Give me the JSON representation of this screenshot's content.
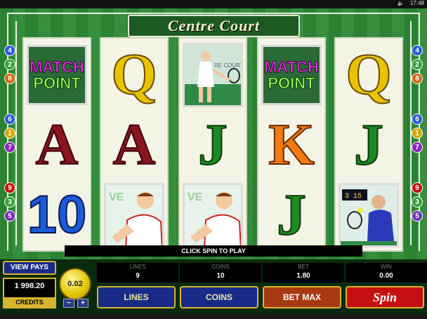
{
  "system": {
    "time": "17:48"
  },
  "title": "Centre Court",
  "reels": [
    [
      "MATCH POINT",
      "A",
      "10"
    ],
    [
      "Q",
      "A",
      "player-serve"
    ],
    [
      "player-woman",
      "J",
      "player-serve"
    ],
    [
      "MATCH POINT",
      "K",
      "J"
    ],
    [
      "Q",
      "J",
      "player-volley"
    ]
  ],
  "match_point": {
    "line1": "MATCH",
    "line2": "POINT"
  },
  "court_sign": "RE COURT",
  "paylines_left": [
    "4",
    "2",
    "8",
    "6",
    "1",
    "7",
    "9",
    "3",
    "5"
  ],
  "paylines_right": [
    "4",
    "2",
    "8",
    "6",
    "1",
    "7",
    "9",
    "3",
    "5"
  ],
  "message": "CLICK SPIN TO PLAY",
  "controls": {
    "view_pays": "VIEW PAYS",
    "credits_value": "1 998.20",
    "credits_label": "CREDITS",
    "coin_value": "0.02",
    "coin_minus": "−",
    "coin_plus": "+",
    "meters": [
      {
        "label": "LINES",
        "value": "9"
      },
      {
        "label": "COINS",
        "value": "10"
      },
      {
        "label": "BET",
        "value": "1.80"
      },
      {
        "label": "WIN",
        "value": "0.00"
      }
    ],
    "lines_button": "LINES",
    "coins_button": "COINS",
    "betmax_button": "BET MAX",
    "spin_button": "Spin"
  },
  "colors": {
    "court": "#2e8a35",
    "gold": "#d7b530",
    "blue": "#1a2a88",
    "spin": "#c41010"
  }
}
